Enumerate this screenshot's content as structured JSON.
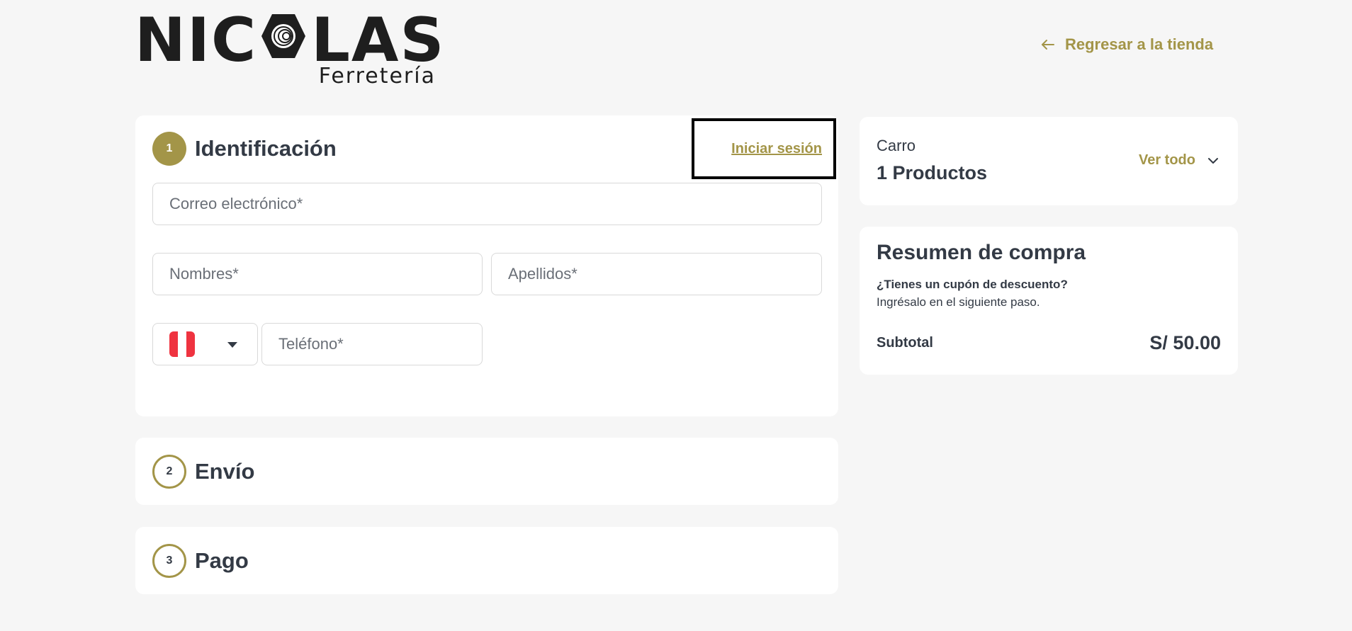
{
  "brand": {
    "logo_text_left": "NIC",
    "logo_text_right": "LAS",
    "logo_subtitle": "Ferretería"
  },
  "header": {
    "back_link_label": "Regresar a la tienda",
    "back_icon": "arrow-left-icon"
  },
  "colors": {
    "accent": "#a39548",
    "text": "#333a45",
    "background": "#f6f6f6",
    "card": "#ffffff"
  },
  "identification": {
    "step_number": "1",
    "title": "Identificación",
    "login_link": "Iniciar sesión",
    "email_placeholder": "Correo electrónico*",
    "first_name_placeholder": "Nombres*",
    "last_name_placeholder": "Apellidos*",
    "country_flag": "peru-flag-icon",
    "phone_placeholder": "Teléfono*"
  },
  "shipping": {
    "step_number": "2",
    "title": "Envío"
  },
  "payment": {
    "step_number": "3",
    "title": "Pago"
  },
  "cart": {
    "label": "Carro",
    "count": "1 Productos",
    "view_all_label": "Ver todo"
  },
  "summary": {
    "title": "Resumen de compra",
    "coupon_question": "¿Tienes un cupón de descuento?",
    "coupon_hint": "Ingrésalo en el siguiente paso.",
    "subtotal_label": "Subtotal",
    "subtotal_value": "S/ 50.00"
  }
}
